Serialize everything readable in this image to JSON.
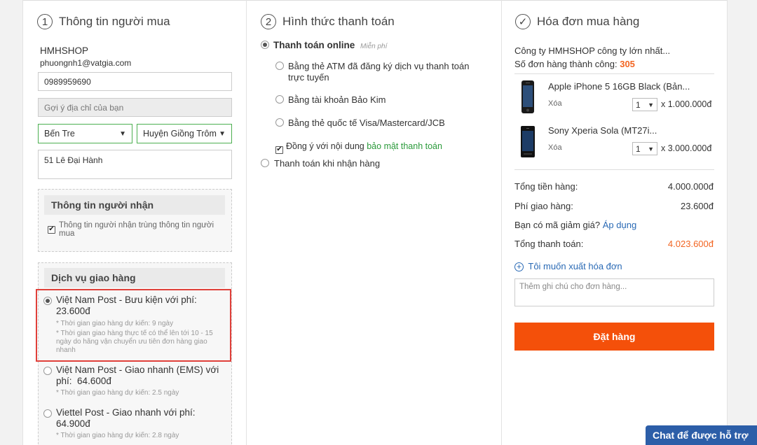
{
  "buyer": {
    "step": "1",
    "title": "Thông tin người mua",
    "shop_name": "HMHSHOP",
    "email": "phuongnh1@vatgia.com",
    "phone": "0989959690",
    "address_suggest_placeholder": "Gợi ý địa chỉ của bạn",
    "province": "Bến Tre",
    "district": "Huyện Giồng Trôm",
    "street": "51 Lê Đại Hành",
    "receiver_box_title": "Thông tin người nhận",
    "receiver_same_label": "Thông tin người nhận trùng thông tin người mua",
    "receiver_same_checked": true,
    "shipping_title": "Dịch vụ giao hàng",
    "shipping_options": [
      {
        "name": "Việt Nam Post - Bưu kiện với phí:",
        "fee": "23.600đ",
        "note1": "* Thời gian giao hàng dự kiến: 9 ngày",
        "note2": "* Thời gian giao hàng thực tế có thể lên tới 10 - 15 ngày do hãng vận chuyển ưu tiên đơn hàng giao nhanh",
        "selected": true
      },
      {
        "name": "Việt Nam Post - Giao nhanh (EMS) với phí:",
        "fee": "64.600đ",
        "note1": "* Thời gian giao hàng dự kiến: 2.5 ngày",
        "selected": false
      },
      {
        "name": "Viettel Post - Giao nhanh với phí:",
        "fee": "64.900đ",
        "note1": "* Thời gian giao hàng dự kiến: 2.8 ngày",
        "selected": false
      }
    ]
  },
  "payment": {
    "step": "2",
    "title": "Hình thức thanh toán",
    "online_label": "Thanh toán online",
    "online_badge": "Miễn phí",
    "online_selected": true,
    "methods": [
      "Bằng thẻ ATM đã đăng ký dịch vụ thanh toán trực tuyến",
      "Bằng tài khoản Bảo Kim",
      "Bằng thẻ quốc tế Visa/Mastercard/JCB"
    ],
    "agree_prefix": "Đồng ý với nội dung",
    "agree_link": "bảo mật thanh toán",
    "agree_checked": true,
    "cod_label": "Thanh toán khi nhận hàng"
  },
  "invoice": {
    "title": "Hóa đơn mua hàng",
    "company": "Công ty HMHSHOP công ty lớn nhất...",
    "success_label": "Số đơn hàng thành công:",
    "success_count": "305",
    "products": [
      {
        "name": "Apple iPhone 5 16GB Black (Bản...",
        "remove": "Xóa",
        "qty": "1",
        "price": "x 1.000.000đ",
        "icon": "iphone-product-image"
      },
      {
        "name": "Sony Xperia Sola (MT27i...",
        "remove": "Xóa",
        "qty": "1",
        "price": "x 3.000.000đ",
        "icon": "sony-xperia-product-image"
      }
    ],
    "subtotal_label": "Tổng tiền hàng:",
    "subtotal": "4.000.000đ",
    "shipping_label": "Phí giao hàng:",
    "shipping_fee": "23.600đ",
    "coupon_label": "Bạn có mã giảm giá?",
    "coupon_link": "Áp dụng",
    "total_label": "Tổng thanh toán:",
    "total": "4.023.600đ",
    "vat_invoice_link": "Tôi muốn xuất hóa đơn",
    "note_placeholder": "Thêm ghi chú cho đơn hàng...",
    "order_button": "Đặt hàng"
  },
  "chat": {
    "label": "Chat để được hỗ trợ"
  },
  "colors": {
    "accent_orange": "#f4500a",
    "link_blue": "#2a6ab5",
    "highlight_red": "#e0403a",
    "chat_blue": "#2c5ea8"
  }
}
